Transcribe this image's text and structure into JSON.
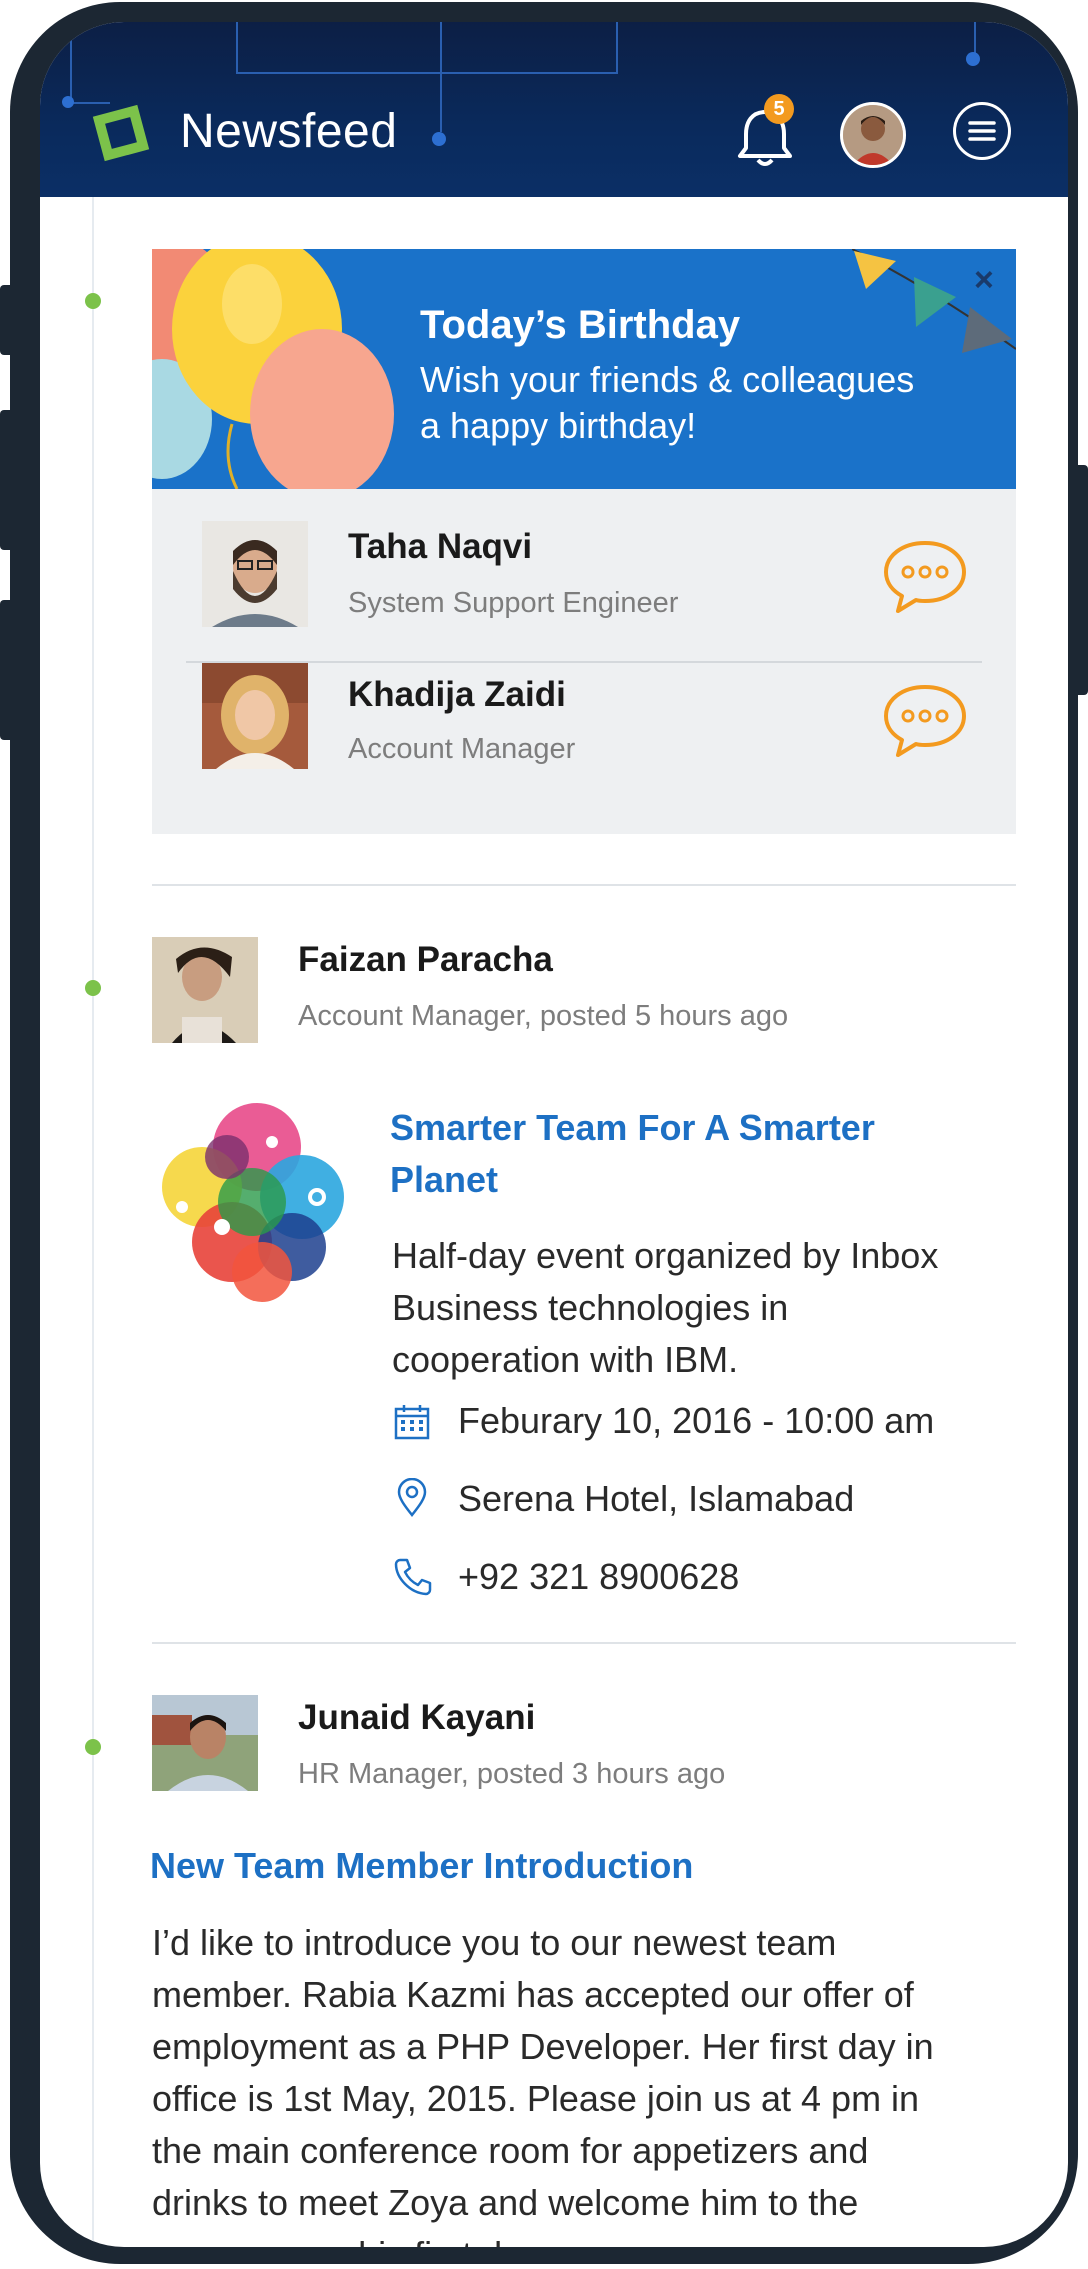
{
  "header": {
    "title": "Newsfeed",
    "notification_count": "5"
  },
  "birthday": {
    "title": "Today’s Birthday",
    "subtitle_line1": "Wish your friends & colleagues",
    "subtitle_line2": "a happy birthday!",
    "close_label": "×",
    "people": [
      {
        "name": "Taha Naqvi",
        "role": "System Support Engineer"
      },
      {
        "name": "Khadija Zaidi",
        "role": "Account Manager"
      }
    ]
  },
  "posts": [
    {
      "author": "Faizan Paracha",
      "meta": "Account Manager, posted 5 hours ago",
      "event": {
        "title_line1": "Smarter Team For A Smarter",
        "title_line2": "Planet",
        "desc_line1": "Half-day event organized by Inbox",
        "desc_line2": "Business technologies in",
        "desc_line3": "cooperation with IBM.",
        "date": "Feburary 10, 2016 - 10:00 am",
        "location": "Serena Hotel, Islamabad",
        "phone": "+92 321 8900628"
      }
    },
    {
      "author": "Junaid Kayani",
      "meta": "HR Manager, posted 3 hours ago",
      "title": "New Team Member Introduction",
      "body_lines": [
        "I’d like to introduce you to our newest team",
        "member. Rabia Kazmi has accepted our offer of",
        "employment as a PHP Developer. Her first day in",
        "office is 1st May, 2015. Please join us at 4 pm in",
        "the main conference room for appetizers and",
        "drinks to meet Zoya and welcome him to the",
        "company on his first day."
      ]
    }
  ],
  "colors": {
    "header_bg": "#0b2a5c",
    "accent_blue": "#1d70c4",
    "banner_blue": "#1a72c9",
    "timeline_green": "#7cc24a",
    "chat_orange": "#f39a1f",
    "badge_orange": "#f39a1f"
  }
}
